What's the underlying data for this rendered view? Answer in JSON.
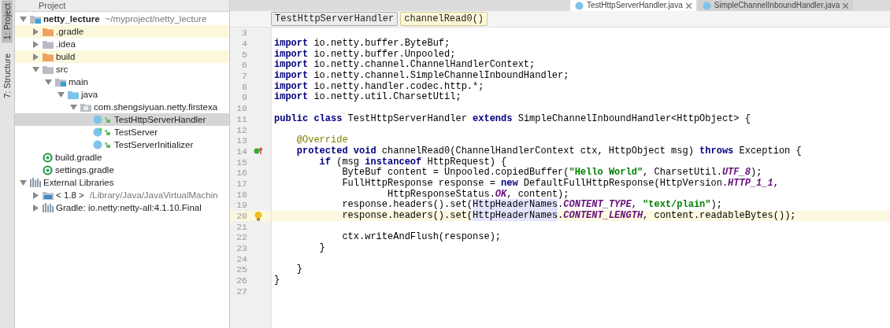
{
  "tool_strip": [
    {
      "label": "1: Project",
      "selected": true
    },
    {
      "label": "7: Structure",
      "selected": false
    }
  ],
  "project_panel": {
    "title": "Project",
    "tree": [
      {
        "label": "netty_lecture",
        "path": "~/myproject/netty_lecture",
        "kind": "module",
        "expanded": true,
        "selected": false,
        "children": [
          {
            "label": ".gradle",
            "kind": "folder",
            "excluded": true,
            "expanded": false,
            "selected": false
          },
          {
            "label": ".idea",
            "kind": "folder",
            "excluded": false,
            "expanded": false,
            "selected": false
          },
          {
            "label": "build",
            "kind": "folder",
            "excluded": true,
            "expanded": false,
            "selected": false
          },
          {
            "label": "src",
            "kind": "folder",
            "excluded": false,
            "expanded": true,
            "selected": false,
            "children": [
              {
                "label": "main",
                "kind": "module",
                "expanded": true,
                "selected": false,
                "children": [
                  {
                    "label": "java",
                    "kind": "source",
                    "expanded": true,
                    "selected": false,
                    "children": [
                      {
                        "label": "com.shengsiyuan.netty.firstexa",
                        "kind": "package",
                        "expanded": true,
                        "selected": false,
                        "children": [
                          {
                            "label": "TestHttpServerHandler",
                            "kind": "class",
                            "selected": true
                          },
                          {
                            "label": "TestServer",
                            "kind": "runnable-class",
                            "selected": false
                          },
                          {
                            "label": "TestServerInitializer",
                            "kind": "class",
                            "selected": false
                          }
                        ]
                      }
                    ]
                  }
                ]
              }
            ]
          },
          {
            "label": "build.gradle",
            "kind": "gradle",
            "selected": false
          },
          {
            "label": "settings.gradle",
            "kind": "gradle",
            "selected": false
          }
        ]
      },
      {
        "label": "External Libraries",
        "kind": "libraries",
        "expanded": true,
        "selected": false,
        "children": [
          {
            "label": "< 1.8 >",
            "path": "/Library/Java/JavaVirtualMachin",
            "kind": "jdk",
            "expanded": false,
            "selected": false
          },
          {
            "label": "Gradle: io.netty:netty-all:4.1.10.Final",
            "kind": "libraries",
            "expanded": false,
            "selected": false
          }
        ]
      }
    ]
  },
  "editor_tabs": [
    {
      "label": "TestHttpServerHandler.java",
      "selected": true
    },
    {
      "label": "SimpleChannelInboundHandler.java",
      "selected": false
    }
  ],
  "breadcrumbs": [
    {
      "label": "TestHttpServerHandler",
      "kind": "class"
    },
    {
      "label": "channelRead0()",
      "kind": "method"
    }
  ],
  "code_lines": [
    {
      "number": "3"
    },
    {
      "number": "4",
      "tokens": [
        {
          "text": "import",
          "kind": "keyword"
        },
        {
          "text": " io.netty.buffer.ByteBuf;",
          "kind": "plain"
        }
      ]
    },
    {
      "number": "5",
      "tokens": [
        {
          "text": "import",
          "kind": "keyword"
        },
        {
          "text": " io.netty.buffer.Unpooled;",
          "kind": "plain"
        }
      ]
    },
    {
      "number": "6",
      "tokens": [
        {
          "text": "import",
          "kind": "keyword"
        },
        {
          "text": " io.netty.channel.ChannelHandlerContext;",
          "kind": "plain"
        }
      ]
    },
    {
      "number": "7",
      "tokens": [
        {
          "text": "import",
          "kind": "keyword"
        },
        {
          "text": " io.netty.channel.SimpleChannelInboundHandler;",
          "kind": "plain"
        }
      ]
    },
    {
      "number": "8",
      "tokens": [
        {
          "text": "import",
          "kind": "keyword"
        },
        {
          "text": " io.netty.handler.codec.http.*;",
          "kind": "plain"
        }
      ]
    },
    {
      "number": "9",
      "tokens": [
        {
          "text": "import",
          "kind": "keyword"
        },
        {
          "text": " io.netty.util.CharsetUtil;",
          "kind": "plain"
        }
      ]
    },
    {
      "number": "10"
    },
    {
      "number": "11",
      "tokens": [
        {
          "text": "public class",
          "kind": "keyword"
        },
        {
          "text": " TestHttpServerHandler ",
          "kind": "plain"
        },
        {
          "text": "extends",
          "kind": "keyword"
        },
        {
          "text": " SimpleChannelInboundHandler<HttpObject> {",
          "kind": "plain"
        }
      ]
    },
    {
      "number": "12"
    },
    {
      "number": "13",
      "tokens": [
        {
          "text": "    @Override",
          "kind": "annotation"
        }
      ]
    },
    {
      "number": "14",
      "override_marker": true,
      "tokens": [
        {
          "text": "    protected void",
          "kind": "keyword"
        },
        {
          "text": " channelRead0(ChannelHandlerContext ctx, HttpObject msg) ",
          "kind": "plain"
        },
        {
          "text": "throws",
          "kind": "keyword"
        },
        {
          "text": " Exception {",
          "kind": "plain"
        }
      ]
    },
    {
      "number": "15",
      "tokens": [
        {
          "text": "        if",
          "kind": "keyword"
        },
        {
          "text": " (msg ",
          "kind": "plain"
        },
        {
          "text": "instanceof",
          "kind": "keyword"
        },
        {
          "text": " HttpRequest) {",
          "kind": "plain"
        }
      ]
    },
    {
      "number": "16",
      "tokens": [
        {
          "text": "            ByteBuf content = Unpooled.copiedBuffer(",
          "kind": "plain"
        },
        {
          "text": "\"Hello World\"",
          "kind": "string"
        },
        {
          "text": ", CharsetUtil.",
          "kind": "plain"
        },
        {
          "text": "UTF_8",
          "kind": "static"
        },
        {
          "text": ");",
          "kind": "plain"
        }
      ]
    },
    {
      "number": "17",
      "tokens": [
        {
          "text": "            FullHttpResponse response = ",
          "kind": "plain"
        },
        {
          "text": "new",
          "kind": "keyword"
        },
        {
          "text": " DefaultFullHttpResponse(HttpVersion.",
          "kind": "plain"
        },
        {
          "text": "HTTP_1_1",
          "kind": "static"
        },
        {
          "text": ",",
          "kind": "plain"
        }
      ]
    },
    {
      "number": "18",
      "tokens": [
        {
          "text": "                    HttpResponseStatus.",
          "kind": "plain"
        },
        {
          "text": "OK",
          "kind": "static"
        },
        {
          "text": ", content);",
          "kind": "plain"
        }
      ]
    },
    {
      "number": "19",
      "tokens": [
        {
          "text": "            response.headers().set(",
          "kind": "plain"
        },
        {
          "text": "HttpHeaderNames",
          "kind": "usage"
        },
        {
          "text": ".",
          "kind": "plain"
        },
        {
          "text": "CONTENT_TYPE",
          "kind": "static"
        },
        {
          "text": ", ",
          "kind": "plain"
        },
        {
          "text": "\"text/plain\"",
          "kind": "string"
        },
        {
          "text": ");",
          "kind": "plain"
        }
      ]
    },
    {
      "number": "20",
      "current": true,
      "intention_bulb": true,
      "tokens": [
        {
          "text": "            response.headers().set(",
          "kind": "plain"
        },
        {
          "text": "HttpHeaderNames",
          "kind": "usage"
        },
        {
          "text": ".",
          "kind": "plain"
        },
        {
          "text": "CONTENT_LENGTH",
          "kind": "static"
        },
        {
          "text": ", content.readableBytes());",
          "kind": "plain"
        }
      ]
    },
    {
      "number": "21"
    },
    {
      "number": "22",
      "tokens": [
        {
          "text": "            ctx.writeAndFlush(response);",
          "kind": "plain"
        }
      ]
    },
    {
      "number": "23",
      "tokens": [
        {
          "text": "        }",
          "kind": "plain"
        }
      ]
    },
    {
      "number": "24"
    },
    {
      "number": "25",
      "tokens": [
        {
          "text": "    }",
          "kind": "plain"
        }
      ]
    },
    {
      "number": "26",
      "tokens": [
        {
          "text": "}",
          "kind": "plain"
        }
      ]
    },
    {
      "number": "27"
    }
  ]
}
